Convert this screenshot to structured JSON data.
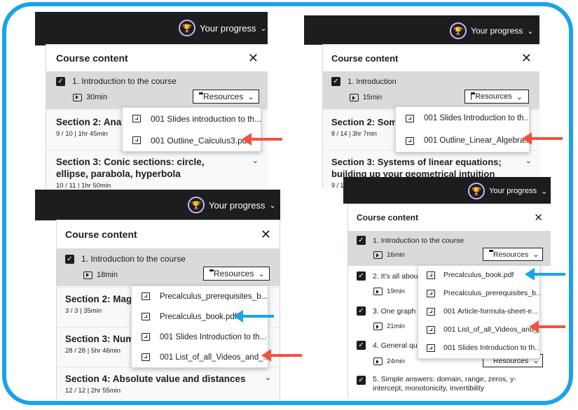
{
  "colors": {
    "frame": "#1aa3e8",
    "arrow_red": "#f0533d",
    "arrow_blue": "#1aa3e8",
    "topbar": "#1c1d1f"
  },
  "progress_label": "Your progress",
  "course_content": "Course content",
  "close": "✕",
  "resources": "Resources",
  "panel_a": {
    "sec1_title": "1. Introduction to the course",
    "sec1_dur": "30min",
    "sec2_title": "Section 2: Analyt",
    "sec2_meta": "9 / 10 | 1hr 45min",
    "sec3_title": "Section 3: Conic sections: circle, ellipse, parabola, hyperbola",
    "sec3_meta": "10 / 11 | 1hr 50min",
    "files": [
      "001 Slides introduction to th...",
      "001 Outline_Calculus3.pdf"
    ]
  },
  "panel_b": {
    "sec1_title": "1. Introduction",
    "sec1_dur": "15min",
    "sec2_title": "Section 2: Some",
    "sec2_meta": "8 / 14 | 3hr 7min",
    "sec3_title": "Section 3: Systems of linear equations; building up your geometrical intuition",
    "sec3_meta": "9 / 1",
    "files": [
      "001 Slides Introduction to th...",
      "001 Outline_Linear_Algebra..."
    ]
  },
  "panel_c": {
    "sec1_title": "1. Introduction to the course",
    "sec1_dur": "18min",
    "sec2_title": "Section 2: Magic",
    "sec2_meta": "3 / 3 | 35min",
    "sec3_title": "Section 3: Numb",
    "sec3_meta": "28 / 28 | 5hr 46min",
    "sec4_title": "Section 4: Absolute value and distances",
    "sec4_meta": "12 / 12 | 2hr 55min",
    "files": [
      "Precalculus_prerequisites_b...",
      "Precalculus_book.pdf",
      "001 Slides Introduction to th...",
      "001 List_of_all_Videos_and_..."
    ]
  },
  "panel_d": {
    "sec1_title": "1. Introduction to the course",
    "sec1_dur": "16min",
    "lectures": [
      {
        "title": "2. It's all about",
        "dur": "19min"
      },
      {
        "title": "3. One graph to",
        "dur": "21min"
      },
      {
        "title": "4. General que",
        "dur": "24min"
      },
      {
        "title": "5. Simple answers: domain, range, zeros, y-intercept, monotonicity, invertibility",
        "dur": ""
      }
    ],
    "files": [
      "Precalculus_book.pdf",
      "Precalculus_prerequisites_b...",
      "001 Article-formula-sheet-e...",
      "001 List_of_all_Videos_and_...",
      "001 Slides Introduction to th..."
    ]
  }
}
